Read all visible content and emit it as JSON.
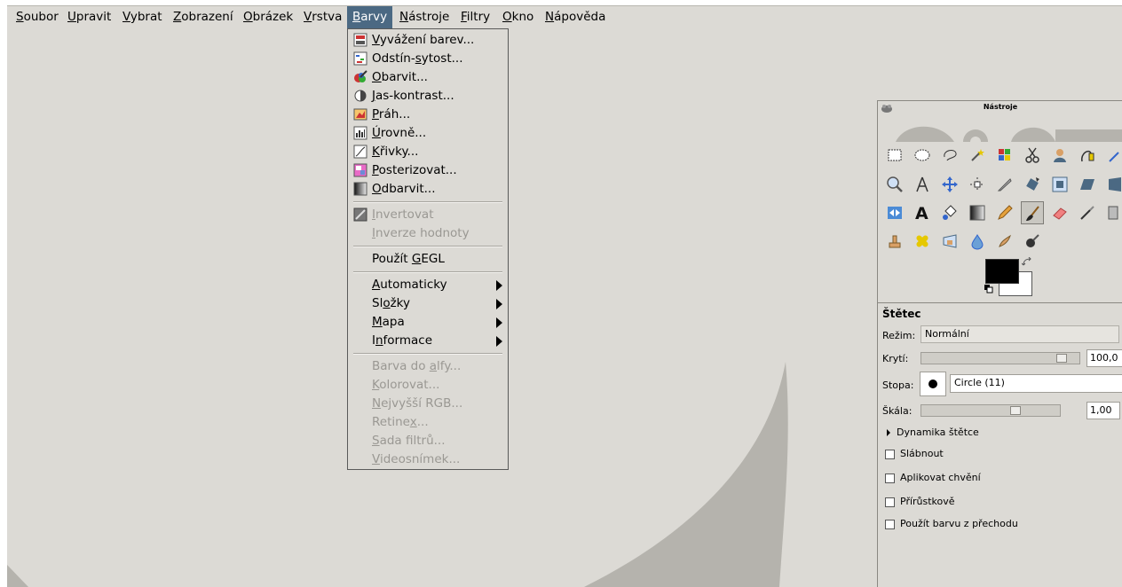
{
  "menubar": {
    "items": [
      {
        "pre": "",
        "ul": "S",
        "post": "oubor"
      },
      {
        "pre": "",
        "ul": "U",
        "post": "pravit"
      },
      {
        "pre": "",
        "ul": "V",
        "post": "ybrat"
      },
      {
        "pre": "",
        "ul": "Z",
        "post": "obrazení"
      },
      {
        "pre": "",
        "ul": "O",
        "post": "brázek"
      },
      {
        "pre": "",
        "ul": "V",
        "post": "rstva"
      },
      {
        "pre": "",
        "ul": "B",
        "post": "arvy"
      },
      {
        "pre": "",
        "ul": "N",
        "post": "ástroje"
      },
      {
        "pre": "",
        "ul": "F",
        "post": "iltry"
      },
      {
        "pre": "",
        "ul": "O",
        "post": "kno"
      },
      {
        "pre": "",
        "ul": "N",
        "post": "ápověda"
      }
    ],
    "active_index": 6
  },
  "colors_menu": {
    "items": [
      {
        "pre": "",
        "ul": "V",
        "post": "yvážení barev...",
        "icon": "color-balance-icon",
        "enabled": true
      },
      {
        "pre": "Odstín-",
        "ul": "s",
        "post": "ytost...",
        "icon": "hue-saturation-icon",
        "enabled": true
      },
      {
        "pre": "",
        "ul": "O",
        "post": "barvit...",
        "icon": "colorize-icon",
        "enabled": true
      },
      {
        "pre": "",
        "ul": "J",
        "post": "as-kontrast...",
        "icon": "brightness-contrast-icon",
        "enabled": true
      },
      {
        "pre": "",
        "ul": "P",
        "post": "ráh...",
        "icon": "threshold-icon",
        "enabled": true
      },
      {
        "pre": "",
        "ul": "Ú",
        "post": "rovně...",
        "icon": "levels-icon",
        "enabled": true
      },
      {
        "pre": "",
        "ul": "K",
        "post": "řivky...",
        "icon": "curves-icon",
        "enabled": true
      },
      {
        "pre": "",
        "ul": "P",
        "post": "osterizovat...",
        "icon": "posterize-icon",
        "enabled": true
      },
      {
        "pre": "",
        "ul": "O",
        "post": "dbarvit...",
        "icon": "desaturate-icon",
        "enabled": true
      },
      {
        "pre": "",
        "ul": "I",
        "post": "nvertovat",
        "icon": "invert-icon",
        "enabled": false
      },
      {
        "pre": "",
        "ul": "I",
        "post": "nverze hodnoty",
        "icon": "",
        "enabled": false
      },
      {
        "pre": "Použít ",
        "ul": "G",
        "post": "EGL",
        "icon": "",
        "enabled": true
      },
      {
        "pre": "",
        "ul": "A",
        "post": "utomaticky",
        "icon": "",
        "enabled": true,
        "submenu": true
      },
      {
        "pre": "Sl",
        "ul": "o",
        "post": "žky",
        "icon": "",
        "enabled": true,
        "submenu": true
      },
      {
        "pre": "",
        "ul": "M",
        "post": "apa",
        "icon": "",
        "enabled": true,
        "submenu": true
      },
      {
        "pre": "I",
        "ul": "n",
        "post": "formace",
        "icon": "",
        "enabled": true,
        "submenu": true
      },
      {
        "pre": "Barva do ",
        "ul": "a",
        "post": "lfy...",
        "icon": "",
        "enabled": false
      },
      {
        "pre": "",
        "ul": "K",
        "post": "olorovat...",
        "icon": "",
        "enabled": false
      },
      {
        "pre": "",
        "ul": "N",
        "post": "ejvyšší RGB...",
        "icon": "",
        "enabled": false
      },
      {
        "pre": "Retine",
        "ul": "x",
        "post": "...",
        "icon": "",
        "enabled": false
      },
      {
        "pre": "",
        "ul": "S",
        "post": "ada filtrů...",
        "icon": "",
        "enabled": false
      },
      {
        "pre": "",
        "ul": "V",
        "post": "ideosnímek...",
        "icon": "",
        "enabled": false
      }
    ]
  },
  "toolbox": {
    "title": "Nástroje",
    "fg_color": "#000000",
    "bg_color": "#ffffff"
  },
  "tool_options": {
    "title": "Štětec",
    "mode_label": "Režim:",
    "mode_value": "Normální",
    "opacity_label": "Krytí:",
    "opacity_value": "100,0",
    "brush_label": "Stopa:",
    "brush_value": "Circle (11)",
    "scale_label": "Škála:",
    "scale_value": "1,00",
    "dynamics_label": "Dynamika štětce",
    "checkboxes": [
      "Slábnout",
      "Aplikovat chvění",
      "Přírůstkově",
      "Použít barvu z přechodu"
    ]
  },
  "colors": {
    "menu_active_bg": "#4b6983",
    "workspace_bg": "#dcdad5"
  }
}
